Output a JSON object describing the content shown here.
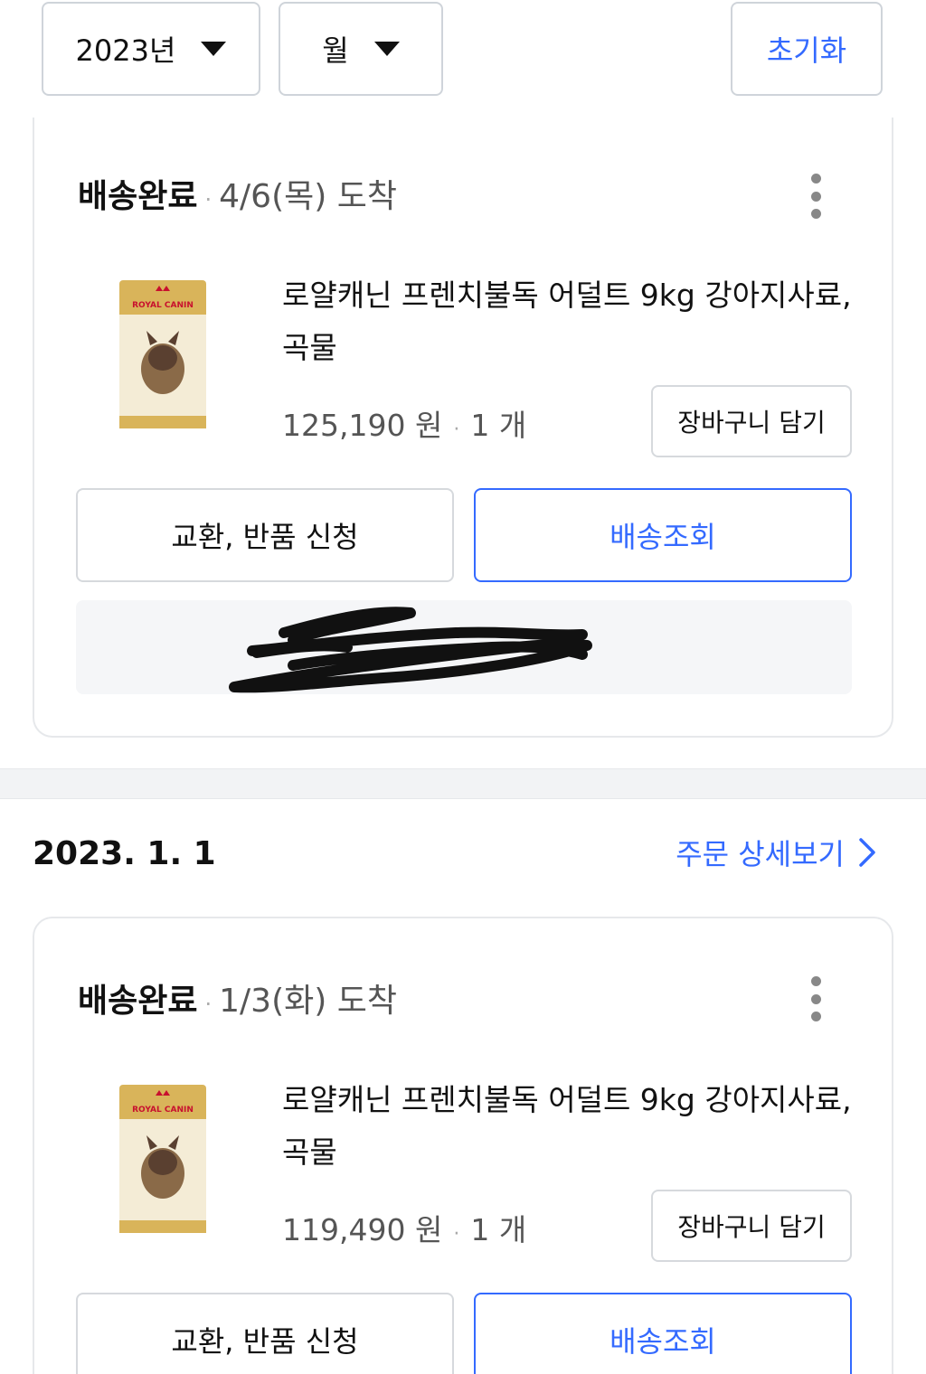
{
  "filters": {
    "year_label": "2023년",
    "month_label": "월",
    "reset_label": "초기화"
  },
  "orders": [
    {
      "status": "배송완료",
      "arrival": "4/6(목) 도착",
      "product": {
        "brand_logo_text": "ROYAL CANIN",
        "name": "로얄캐닌 프렌치불독 어덜트 9kg 강아지사료, 곡물",
        "price": "125,190 원",
        "quantity": "1 개"
      },
      "cart_label": "장바구니 담기",
      "exchange_label": "교환, 반품 신청",
      "tracking_label": "배송조회"
    },
    {
      "date": "2023. 1. 1",
      "detail_link": "주문 상세보기",
      "status": "배송완료",
      "arrival": "1/3(화) 도착",
      "product": {
        "brand_logo_text": "ROYAL CANIN",
        "name": "로얄캐닌 프렌치불독 어덜트 9kg 강아지사료, 곡물",
        "price": "119,490 원",
        "quantity": "1 개"
      },
      "cart_label": "장바구니 담기",
      "exchange_label": "교환, 반품 신청",
      "tracking_label": "배송조회"
    }
  ],
  "icons": {
    "dropdown": "caret-down-icon",
    "more": "more-vertical-icon",
    "link_arrow": "chevron-right-icon"
  },
  "colors": {
    "accent": "#346aff",
    "border": "#d6d9dd",
    "muted_text": "#555555"
  }
}
